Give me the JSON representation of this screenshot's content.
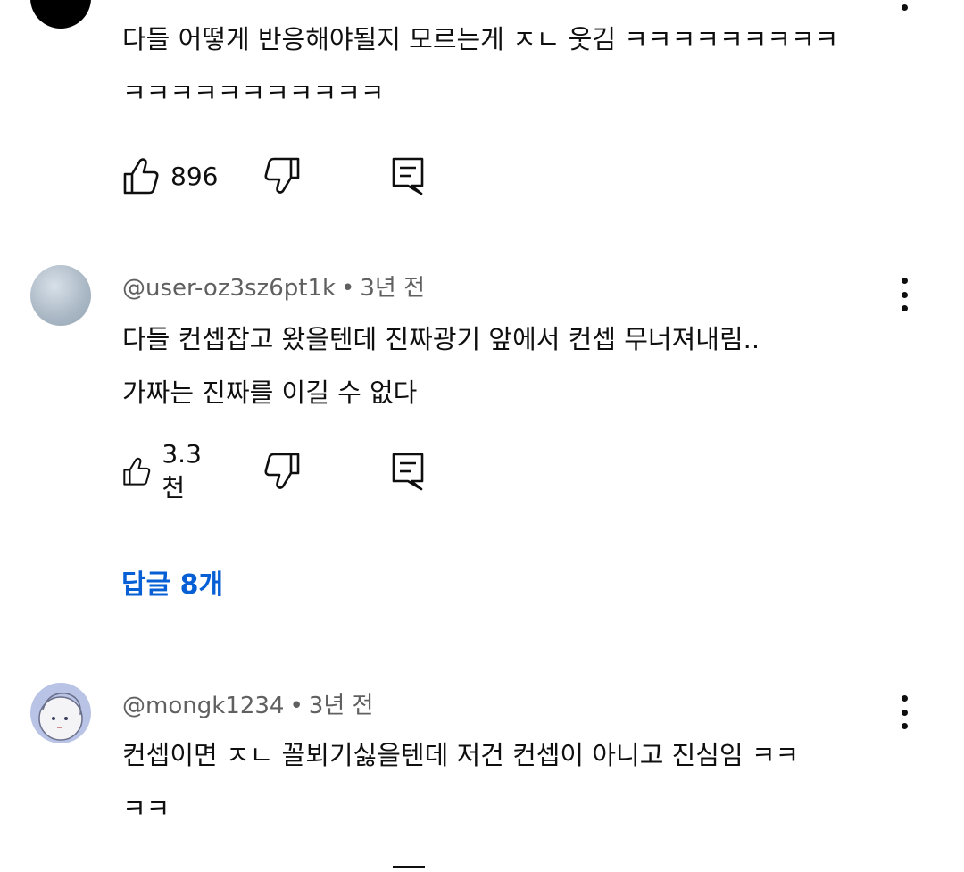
{
  "comments": [
    {
      "author": "",
      "time": "",
      "lines": [
        "다들 어떻게 반응해야될지 모르는게 ㅈㄴ 웃김 ㅋㅋㅋㅋㅋㅋㅋㅋㅋ",
        "ㅋㅋㅋㅋㅋㅋㅋㅋㅋㅋㅋ"
      ],
      "likes": "896"
    },
    {
      "author": "@user-oz3sz6pt1k",
      "time": "3년 전",
      "lines": [
        "다들 컨셉잡고 왔을텐데 진짜광기 앞에서 컨셉 무너져내림..",
        "가짜는 진짜를 이길 수 없다"
      ],
      "likes": "3.3천",
      "replies_label": "답글 8개"
    },
    {
      "author": "@mongk1234",
      "time": "3년 전",
      "lines": [
        "컨셉이면 ㅈㄴ 꼴뵈기싫을텐데 저건 컨셉이 아니고 진심임 ㅋㅋ",
        "ㅋㅋ"
      ]
    }
  ],
  "separator": "•",
  "colors": {
    "link": "#065fd4",
    "meta": "#606060",
    "text": "#0f0f0f"
  },
  "icons": [
    "thumbs-up-icon",
    "thumbs-down-icon",
    "reply-icon",
    "more-vert-icon"
  ]
}
